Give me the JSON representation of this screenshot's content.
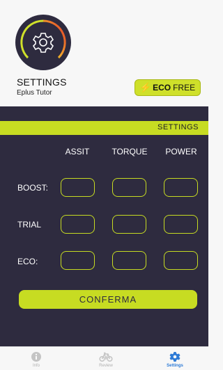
{
  "header": {
    "title": "SETTINGS",
    "subtitle": "Eplus Tutor",
    "eco_button": {
      "bolt": "⚡",
      "strong": "ECO",
      "rest": "FREE"
    }
  },
  "panel": {
    "section_label": "SETTINGS",
    "columns": [
      "ASSIT",
      "TORQUE",
      "POWER"
    ],
    "rows": [
      "BOOST:",
      "TRIAL",
      "ECO:"
    ],
    "confirm_label": "CONFERMA"
  },
  "tabs": [
    {
      "label": "Info",
      "icon": "info-icon",
      "active": false
    },
    {
      "label": "Review",
      "icon": "bicycle-icon",
      "active": false
    },
    {
      "label": "Settings",
      "icon": "gear-icon",
      "active": true
    }
  ],
  "colors": {
    "accent": "#c7dc22",
    "panel": "#2e2b3f",
    "tab_active": "#2e7bd6"
  }
}
